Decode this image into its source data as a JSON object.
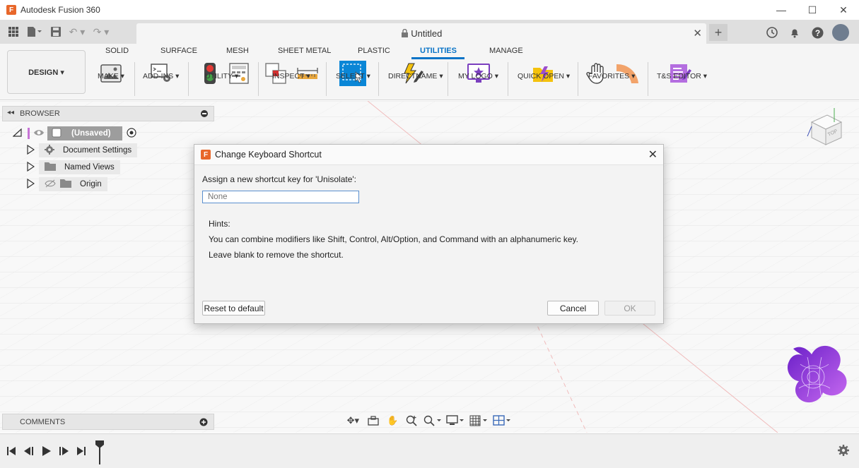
{
  "app": {
    "title": "Autodesk Fusion 360",
    "logo_letter": "F"
  },
  "document": {
    "tab_title": "Untitled",
    "close_glyph": "✕",
    "new_tab_glyph": "+"
  },
  "ribbon": {
    "workspace": "DESIGN ▾",
    "tabs": [
      "SOLID",
      "SURFACE",
      "MESH",
      "SHEET METAL",
      "PLASTIC",
      "UTILITIES",
      "MANAGE"
    ],
    "active_tab": "UTILITIES",
    "groups": [
      "MAKE ▾",
      "ADD-INS ▾",
      "UTILITY ▾",
      "INSPECT ▾",
      "SELECT ▾",
      "DIRECTNAME ▾",
      "MY LOGO ▾",
      "QUICK OPEN ▾",
      "FAVORITES ▾",
      "T&S EDITOR ▾"
    ]
  },
  "browser": {
    "label": "BROWSER",
    "collapse_glyph": "◂◂",
    "root": "(Unsaved)",
    "items": [
      "Document Settings",
      "Named Views",
      "Origin"
    ]
  },
  "comments": {
    "label": "COMMENTS"
  },
  "dialog": {
    "title": "Change Keyboard Shortcut",
    "prompt": "Assign a new shortcut key for 'Unisolate':",
    "input_placeholder": "None",
    "input_value": "",
    "hints_title": "Hints:",
    "hint_1": "You can combine modifiers like Shift, Control, Alt/Option, and Command with an alphanumeric key.",
    "hint_2": "Leave blank to remove the shortcut.",
    "reset_label": "Reset to default",
    "cancel_label": "Cancel",
    "ok_label": "OK",
    "close_glyph": "✕"
  },
  "viewcube": {
    "face": "TOP"
  },
  "colors": {
    "accent": "#0a74c7",
    "brand": "#e8672a"
  }
}
